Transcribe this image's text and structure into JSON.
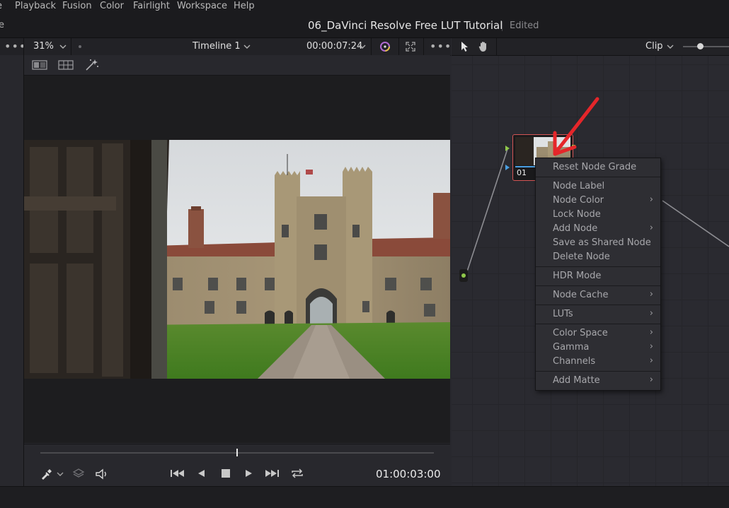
{
  "menubar": {
    "items": [
      "Playback",
      "Fusion",
      "Color",
      "Fairlight",
      "Workspace",
      "Help"
    ],
    "partial_left": "e"
  },
  "titlebar": {
    "project_title": "06_DaVinci Resolve Free LUT Tutorial",
    "status": "Edited"
  },
  "viewer_toolbar": {
    "more_label": "•••",
    "zoom": "31%",
    "timeline_name": "Timeline 1",
    "timecode": "00:00:07:24",
    "more_right_label": "•••"
  },
  "node_toolbar": {
    "mode": "Clip"
  },
  "transport": {
    "timecode": "01:00:03:00",
    "playhead_fraction": 0.5
  },
  "node": {
    "label": "01"
  },
  "context_menu": {
    "items": [
      {
        "label": "Reset Node Grade",
        "submenu": false
      },
      {
        "label": "Node Label",
        "submenu": false
      },
      {
        "label": "Node Color",
        "submenu": true
      },
      {
        "label": "Lock Node",
        "submenu": false
      },
      {
        "label": "Add Node",
        "submenu": true
      },
      {
        "label": "Save as Shared Node",
        "submenu": false
      },
      {
        "label": "Delete Node",
        "submenu": false
      },
      {
        "label": "HDR Mode",
        "submenu": false
      },
      {
        "label": "Node Cache",
        "submenu": true
      },
      {
        "label": "LUTs",
        "submenu": true
      },
      {
        "label": "Color Space",
        "submenu": true
      },
      {
        "label": "Gamma",
        "submenu": true
      },
      {
        "label": "Channels",
        "submenu": true
      },
      {
        "label": "Add Matte",
        "submenu": true
      }
    ],
    "arrow_glyph": "›"
  },
  "colors": {
    "accent_node_border": "#d45555",
    "annotation_arrow": "#e5262a",
    "node_input_green": "#8fc84a",
    "node_input_blue": "#4a9ee0"
  }
}
